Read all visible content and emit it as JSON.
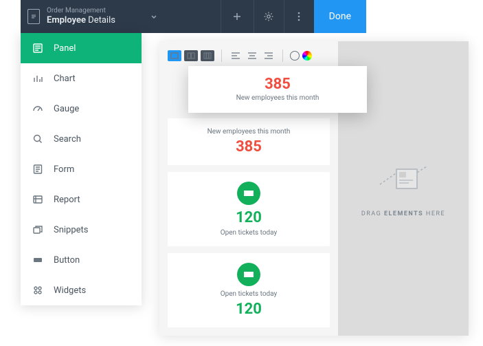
{
  "header": {
    "breadcrumb_top": "Order Management",
    "breadcrumb_main": "Employee",
    "breadcrumb_suffix": " Details",
    "done_label": "Done"
  },
  "sidebar": {
    "items": [
      {
        "label": "Panel"
      },
      {
        "label": "Chart"
      },
      {
        "label": "Gauge"
      },
      {
        "label": "Search"
      },
      {
        "label": "Form"
      },
      {
        "label": "Report"
      },
      {
        "label": "Snippets"
      },
      {
        "label": "Button"
      },
      {
        "label": "Widgets"
      }
    ]
  },
  "popover": {
    "value": "385",
    "label": "New employees this month"
  },
  "cards": [
    {
      "label": "New employees this month",
      "value": "385",
      "type": "red"
    },
    {
      "label": "Open tickets today",
      "value": "120",
      "type": "green"
    },
    {
      "label": "Open tickets today",
      "value": "120",
      "type": "green-alt"
    }
  ],
  "dropzone": {
    "text_prefix": "DRAG ",
    "text_bold": "ELEMENTS",
    "text_suffix": " HERE"
  },
  "colors": {
    "accent_blue": "#2196f3",
    "accent_green": "#0eb37a",
    "stat_red": "#f04e3e",
    "stat_green": "#13b05b"
  }
}
